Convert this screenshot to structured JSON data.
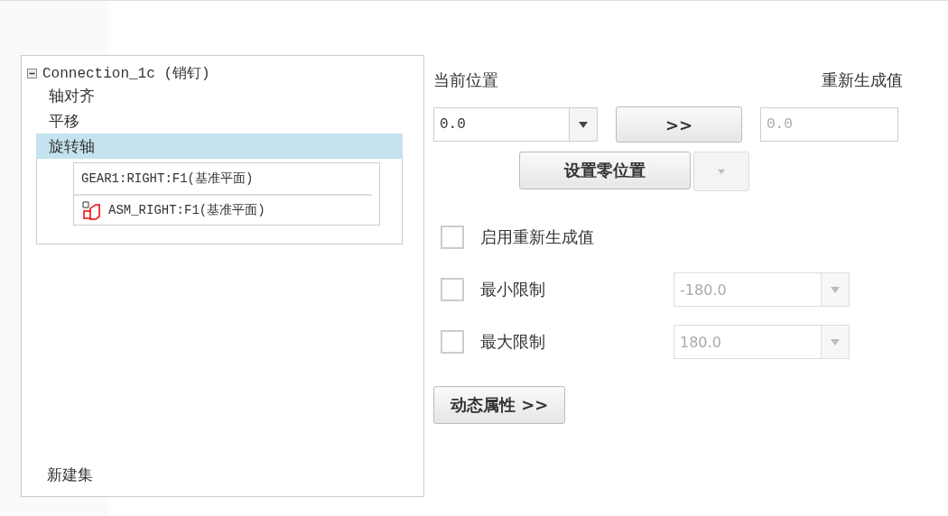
{
  "tree": {
    "label": "Connection_1c (销钉)",
    "expanded": true,
    "children": [
      {
        "label": "轴对齐",
        "selected": false
      },
      {
        "label": "平移",
        "selected": false
      },
      {
        "label": "旋转轴",
        "selected": true
      }
    ]
  },
  "references": [
    {
      "label": "GEAR1:RIGHT:F1(基准平面)",
      "kind": "plain"
    },
    {
      "label": "ASM_RIGHT:F1(基准平面)",
      "kind": "icon"
    }
  ],
  "new_set": "新建集",
  "current_position_label": "当前位置",
  "regen_label": "重新生成值",
  "position_combo": {
    "value": "0.0"
  },
  "copy_button": ">>",
  "regen_field": {
    "value": "0.0",
    "disabled": true
  },
  "zero_button": "设置零位置",
  "zero_dropdown": {
    "disabled": true
  },
  "options": [
    {
      "kind": "checkbox",
      "label": "启用重新生成值",
      "checked": false
    },
    {
      "kind": "limit",
      "label": "最小限制",
      "checked": false,
      "value": "-180.0",
      "disabled": true
    },
    {
      "kind": "limit",
      "label": "最大限制",
      "checked": false,
      "value": "180.0",
      "disabled": true
    }
  ],
  "dynamic_button": "动态属性 >>"
}
